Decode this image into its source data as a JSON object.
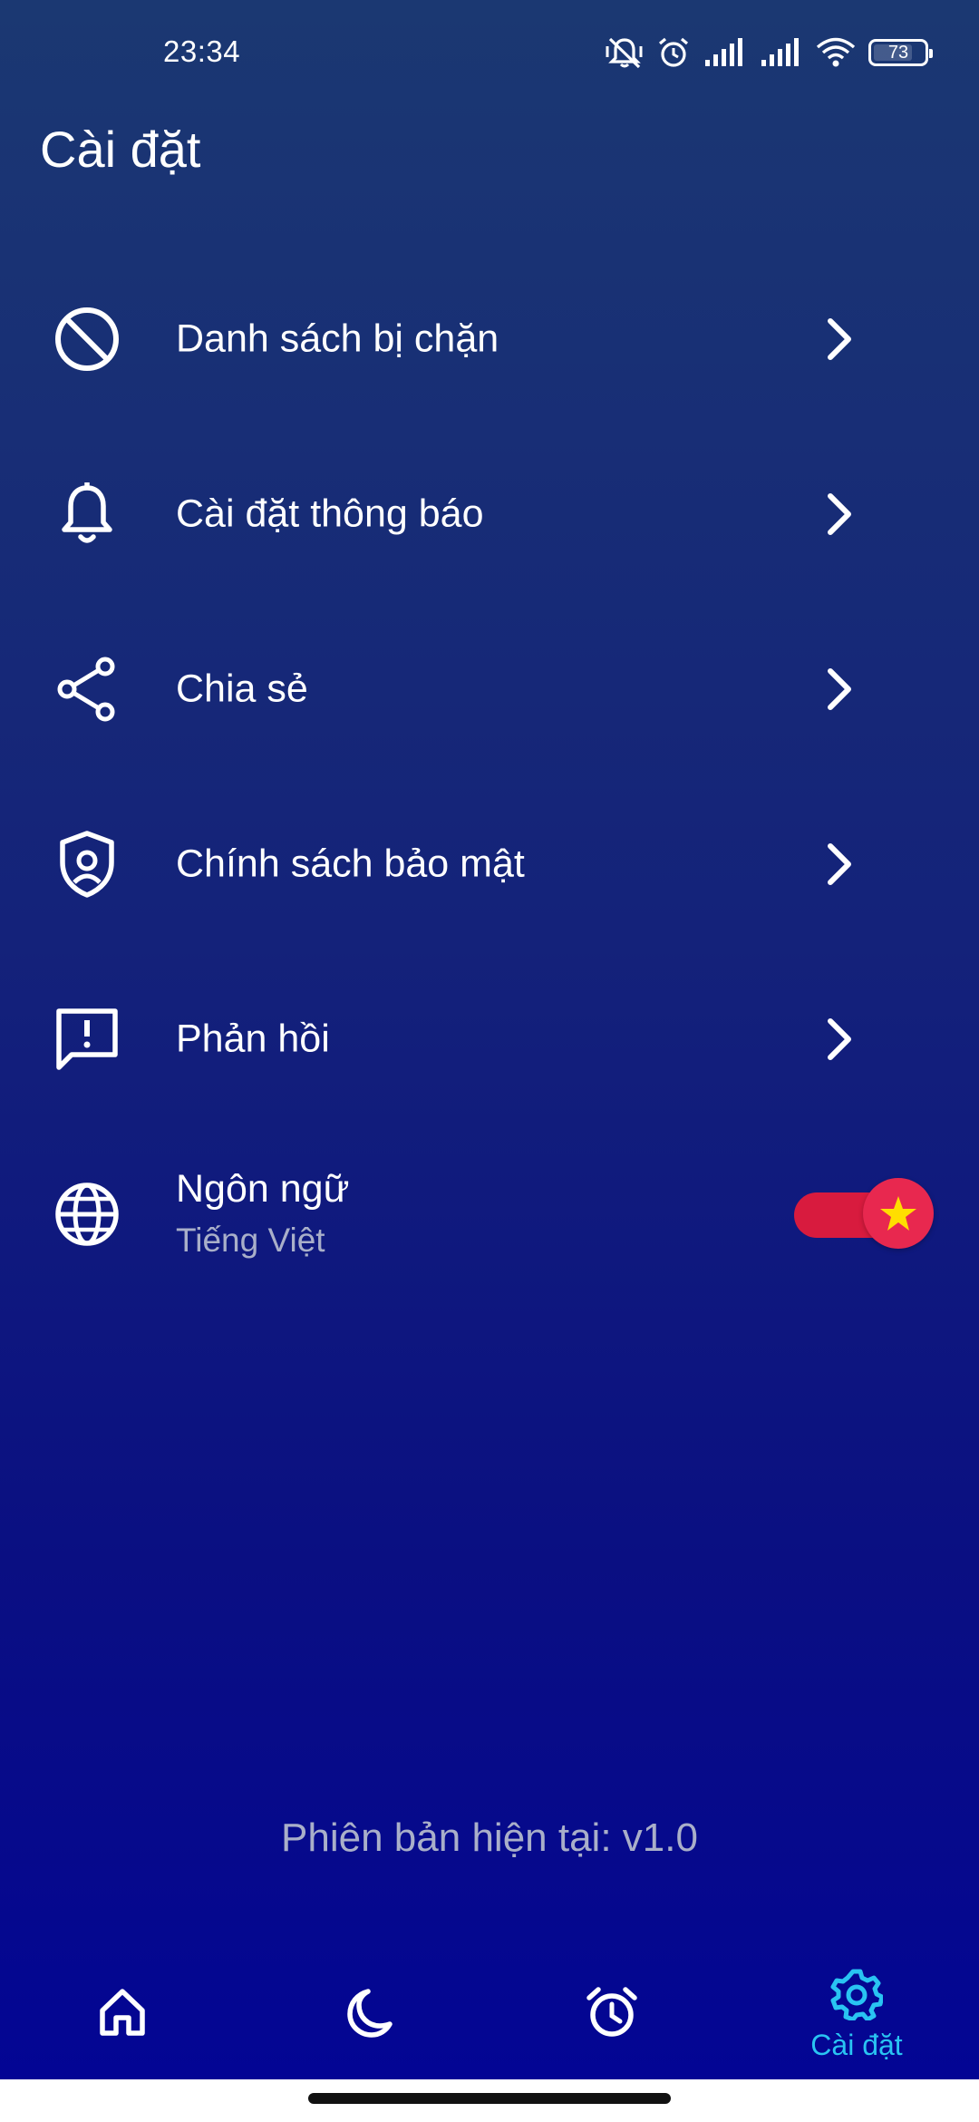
{
  "status_bar": {
    "time": "23:34",
    "battery": "73"
  },
  "page": {
    "title": "Cài đặt"
  },
  "settings": {
    "items": [
      {
        "label": "Danh sách bị chặn",
        "icon": "block-icon"
      },
      {
        "label": "Cài đặt thông báo",
        "icon": "bell-icon"
      },
      {
        "label": "Chia sẻ",
        "icon": "share-icon"
      },
      {
        "label": "Chính sách bảo mật",
        "icon": "privacy-shield-icon"
      },
      {
        "label": "Phản hồi",
        "icon": "feedback-icon"
      }
    ],
    "language": {
      "label": "Ngôn ngữ",
      "value": "Tiếng Việt",
      "icon": "globe-icon",
      "flag": "vietnam-flag-icon"
    }
  },
  "version": {
    "text": "Phiên bản hiện tại: v1.0"
  },
  "bottom_nav": {
    "items": [
      {
        "icon": "home-icon",
        "label": ""
      },
      {
        "icon": "moon-icon",
        "label": ""
      },
      {
        "icon": "alarm-clock-icon",
        "label": ""
      },
      {
        "icon": "gear-icon",
        "label": "Cài đặt",
        "active": true
      }
    ]
  },
  "colors": {
    "background_top": "#1b3872",
    "background_bottom": "#030594",
    "accent": "#29c4f2",
    "toggle": "#e8284f",
    "secondary_text": "#a9afc9"
  }
}
